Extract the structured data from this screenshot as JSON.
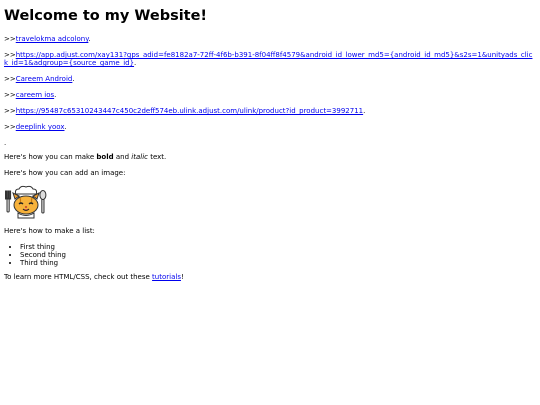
{
  "page": {
    "title": "Welcome to my Website!",
    "prefix": ">>",
    "links": [
      {
        "text": "travelokma adcolony",
        "suffix": "."
      },
      {
        "text": "https://app.adjust.com/xay131?gps_adid=fe8182a7-72ff-4f6b-b391-8f04ff8f4579&android_id_lower_md5={android_id_md5}&s2s=1&unityads_click_id=1&adgroup={source_game_id}",
        "suffix": "."
      },
      {
        "text": "Careem Android",
        "suffix": "."
      },
      {
        "text": "careem ios",
        "suffix": "."
      },
      {
        "text": "https://95487c65310243447c450c2deff574eb.ulink.adjust.com/ulink/product?id_product=3992711",
        "suffix": "."
      },
      {
        "text": "deeplink yoox",
        "suffix": "."
      }
    ],
    "dot": ".",
    "formatting": {
      "before": "Here's how you can make ",
      "bold": "bold",
      "middle": " and ",
      "italic": "italic",
      "after": " text."
    },
    "image_intro": "Here's how you can add an image:",
    "list_intro": "Here's how to make a list:",
    "list_items": [
      "First thing",
      "Second thing",
      "Third thing"
    ],
    "learn": {
      "before": "To learn more HTML/CSS, check out these ",
      "link": "tutorials",
      "after": "!"
    }
  }
}
